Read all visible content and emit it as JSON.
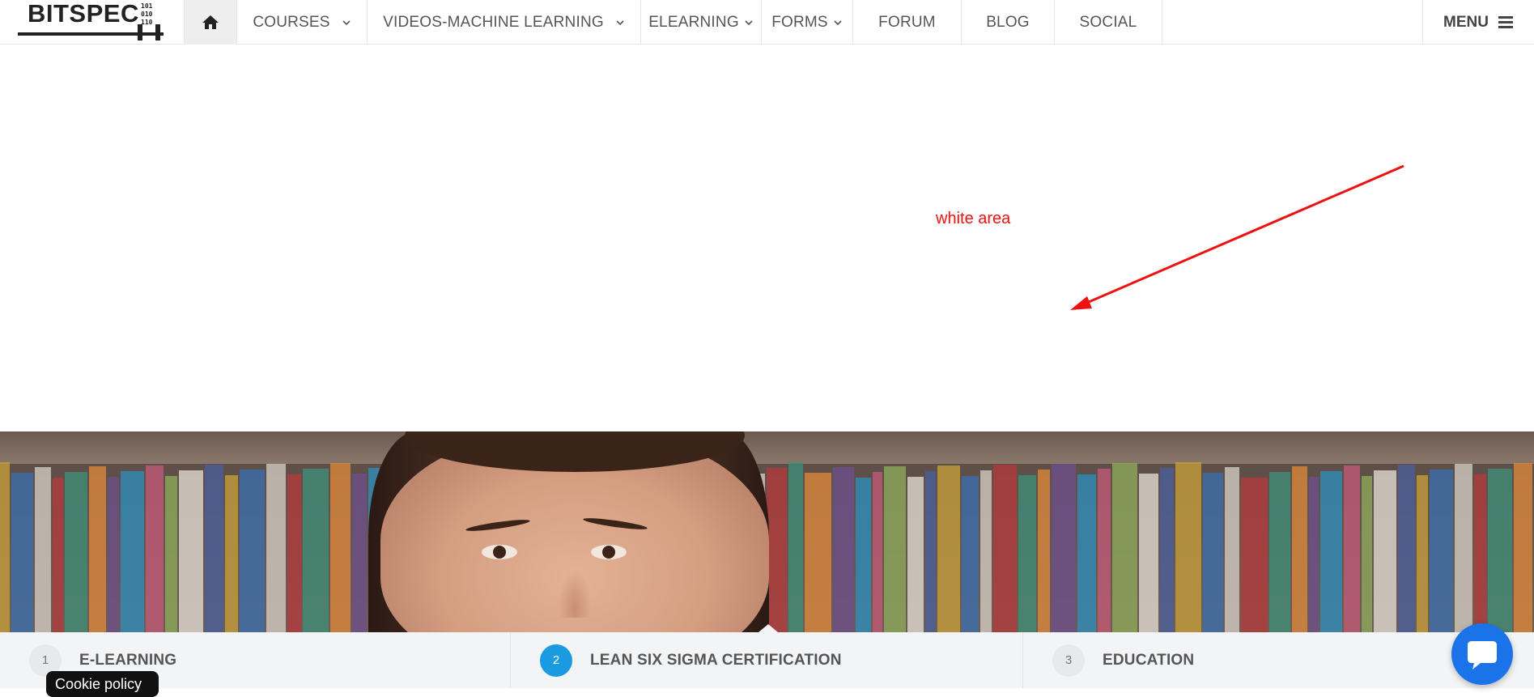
{
  "brand": {
    "logo_text": "BITSPEC",
    "logo_bits": [
      "101",
      "010",
      "110"
    ]
  },
  "nav": {
    "home_icon": "home-icon",
    "items": [
      {
        "label": "COURSES",
        "has_dropdown": true
      },
      {
        "label": "VIDEOS-MACHINE LEARNING",
        "has_dropdown": true
      },
      {
        "label": "ELEARNING",
        "has_dropdown": true
      },
      {
        "label": "FORMS",
        "has_dropdown": true
      },
      {
        "label": "FORUM",
        "has_dropdown": false
      },
      {
        "label": "BLOG",
        "has_dropdown": false
      },
      {
        "label": "SOCIAL",
        "has_dropdown": false
      }
    ],
    "menu_label": "MENU",
    "menu_icon": "hamburger-icon"
  },
  "annotation": {
    "text": "white area",
    "color": "#ee1111"
  },
  "tabs": [
    {
      "num": "1",
      "label": "E-LEARNING",
      "active": false
    },
    {
      "num": "2",
      "label": "LEAN SIX SIGMA CERTIFICATION",
      "active": true
    },
    {
      "num": "3",
      "label": "EDUCATION",
      "active": false
    }
  ],
  "cookie": {
    "label": "Cookie policy"
  },
  "chat": {
    "icon": "chat-bubble-icon"
  },
  "colors": {
    "accent": "#1a9ae0",
    "chat": "#1a73e8",
    "annotation": "#ee1111"
  }
}
